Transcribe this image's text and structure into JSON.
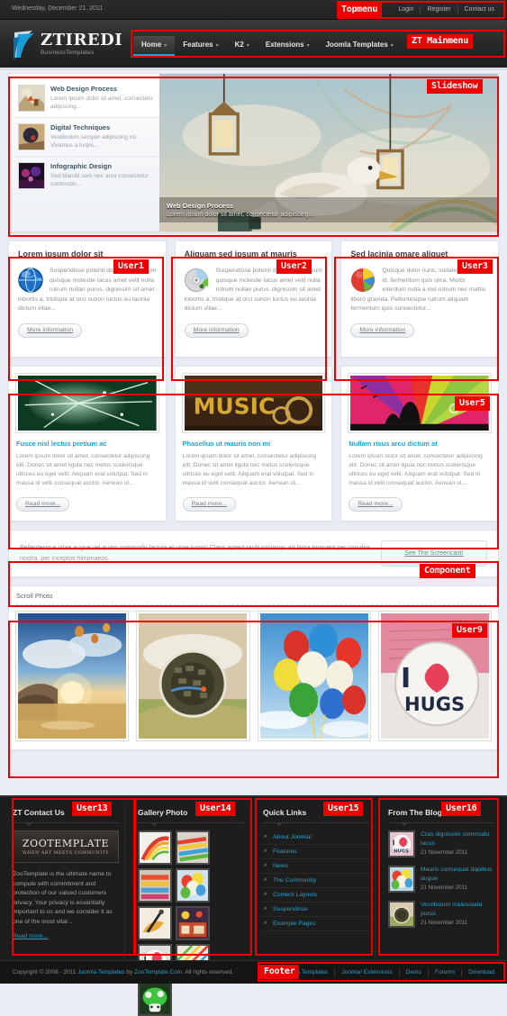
{
  "topbar": {
    "date": "Wednesday, December 21, 2011",
    "links": [
      "Login",
      "Register",
      "Contact us"
    ]
  },
  "header": {
    "logo_title": "ZTIREDI",
    "logo_subtitle": "BusinessTemplates",
    "menu": [
      {
        "label": "Home",
        "caret": "▾",
        "active": true
      },
      {
        "label": "Features",
        "caret": "▾",
        "active": false
      },
      {
        "label": "K2",
        "caret": "▾",
        "active": false
      },
      {
        "label": "Extensions",
        "caret": "▾",
        "active": false
      },
      {
        "label": "Joomla Templates",
        "caret": "▾",
        "active": false
      }
    ]
  },
  "annotations": [
    {
      "id": "topmenu",
      "label": "Topmenu"
    },
    {
      "id": "mainmenu",
      "label": "ZT Mainmenu"
    },
    {
      "id": "slideshow",
      "label": "Slideshow"
    },
    {
      "id": "user1",
      "label": "User1"
    },
    {
      "id": "user2",
      "label": "User2"
    },
    {
      "id": "user3",
      "label": "User3"
    },
    {
      "id": "user5",
      "label": "User5"
    },
    {
      "id": "component",
      "label": "Component"
    },
    {
      "id": "user9",
      "label": "User9"
    },
    {
      "id": "user13",
      "label": "User13"
    },
    {
      "id": "user14",
      "label": "User14"
    },
    {
      "id": "user15",
      "label": "User15"
    },
    {
      "id": "user16",
      "label": "User16"
    },
    {
      "id": "footer",
      "label": "Footer"
    }
  ],
  "slideshow": {
    "items": [
      {
        "title": "Web Design Process",
        "desc": "Lorem ipsum dolor sit amet, consectetur adipiscing...",
        "active": true
      },
      {
        "title": "Digital Techniques",
        "desc": "Vestibulum semper adipiscing mi. Vivamus a turpis...",
        "active": false
      },
      {
        "title": "Infographic Design",
        "desc": "Sed blandit sem nec arcu consectetur commodo....",
        "active": false
      }
    ],
    "caption_title": "Web Design Process",
    "caption_desc": "Lorem ipsum dolor sit amet, consectetur adipiscing..."
  },
  "user_boxes": [
    {
      "heading": "Lorem ipsum dolor sit",
      "icon": "globe-icon",
      "text": "Suspendisse potenti donec cond ipsum quisque molestie lacus amet velit nulla rutrum nullan purus. dignissim sit amet lobortis a, tristique at orci sunon luctus eu lacinia dictum vitae...",
      "button": "More information"
    },
    {
      "heading": "Aliquam sed ipsum at mauris",
      "icon": "disc-icon",
      "text": "Suspendisse potenti donec cond ipsum quisque molestie lacus amet velit nulla rutrum nullan purus. dignissim sit amet lobortis a, tristique at orci sunon luctus eu lacinia dictum vitae...",
      "button": "More information"
    },
    {
      "heading": "Sed lacinia omare aliquet",
      "icon": "piechart-icon",
      "text": "Quisque dolor nunc, sodales in feugiat id, fermentum quis uma. Morbi interdum nulla a nisl rutrum nec mattis libero gravida. Pellentesque rutrum aliquam  fermentum quis consectetur...",
      "button": "More information"
    }
  ],
  "blog_cards": [
    {
      "image": "green-burst-image",
      "title": "Fusce nisl lectus pretium ac",
      "text": "Lorem ipsum dolor sit amet, consectetur adipiscing elit. Donec sit amet ligula nec metus scelerisque ultrices eu eget velit. Aliquam erat volutpat. Sed in massa id velit consequat auctor. Aenean ut...",
      "button": "Read more..."
    },
    {
      "image": "music-gold-image",
      "title": "Phasellus ut mauris non mi",
      "text": "Lorem ipsum dolor sit amet, consectetur adipiscing elit. Donec sit amet ligula nec metus scelerisque ultrices eu eget velit. Aliquam erat volutpat. Sed in massa id velit consequat auctor. Aenean ut...",
      "button": "Read more..."
    },
    {
      "image": "colorful-rays-image",
      "title": "Nullam risus arcu dictum at",
      "text": "Lorem ipsum dolor sit amet, consectetur adipiscing elit. Donec sit amet ligula nec metus scelerisque ultrices eu eget velit. Aliquam erat volutpat. Sed in massa id velit consequat auctor. Aenean ut...",
      "button": "Read more..."
    }
  ],
  "component": {
    "text": "Pellentesque vitae augue vel quam commodo lacinia et vitae turpis! Class aptent taciti sociosqu ad litora torquent per conubia nostra, per inceptos himenaeos.",
    "button": "See The Screencast!"
  },
  "scroll_photo": {
    "title": "Scroll Photo",
    "photos": [
      "sunset-sea-balloons-image",
      "tunnel-sphere-image",
      "balloons-sky-image",
      "i-love-hugs-image"
    ]
  },
  "footer_modules": {
    "contact": {
      "title": "ZT Contact Us",
      "brand": "ZOOTEMPLATE",
      "brand_sub": "WHEN ART MEETS COMMUNITY",
      "text": "ZooTemplate is the ultimate name to compute with commitment and protection of our valued customers privacy. Your privacy is essentially important to us and we consider it as one of the most vital ..",
      "link": "Read more..."
    },
    "gallery": {
      "title": "Gallery Photo",
      "cells": [
        "swirl-image",
        "colorpaper-image",
        "crayons-image",
        "balloons-image",
        "pen-leaf-image",
        "fair-image",
        "hugs-image",
        "pattern-image",
        "mushroom-image"
      ]
    },
    "quick_links": {
      "title": "Quick Links",
      "items": [
        "About Joomla!",
        "Features",
        "News",
        "The Community",
        "Content Layouts",
        "Suspendisse",
        "Example Pages"
      ]
    },
    "blog": {
      "title": "From The Blog",
      "posts": [
        {
          "thumb": "hugs-thumb",
          "title": "Cras dignissim commodo lacus",
          "date": "21 November 2011"
        },
        {
          "thumb": "balloons-thumb",
          "title": "Mauris consequat dapibus augue",
          "date": "21 November 2011"
        },
        {
          "thumb": "tunnel-thumb",
          "title": "Vestibulum malesuada purus",
          "date": "21 November 2011"
        }
      ]
    }
  },
  "bottom_footer": {
    "copy_prefix": "Copyright © 2008 - 2011 ",
    "copy_link1": "Joomla Templates",
    "copy_mid": " by ",
    "copy_link2": "ZooTemplate.Com",
    "copy_suffix": ". All rights reserved.",
    "links": [
      "Joomla Templates",
      "Joomla! Extensions",
      "Demo",
      "Forums",
      "Download"
    ]
  },
  "colors": {
    "accent_red": "#ee0000",
    "link_blue": "#2d9ec4",
    "title_blue": "#17a4dd",
    "page_bg": "#e9edf3",
    "dark": "#1d1d1d"
  }
}
